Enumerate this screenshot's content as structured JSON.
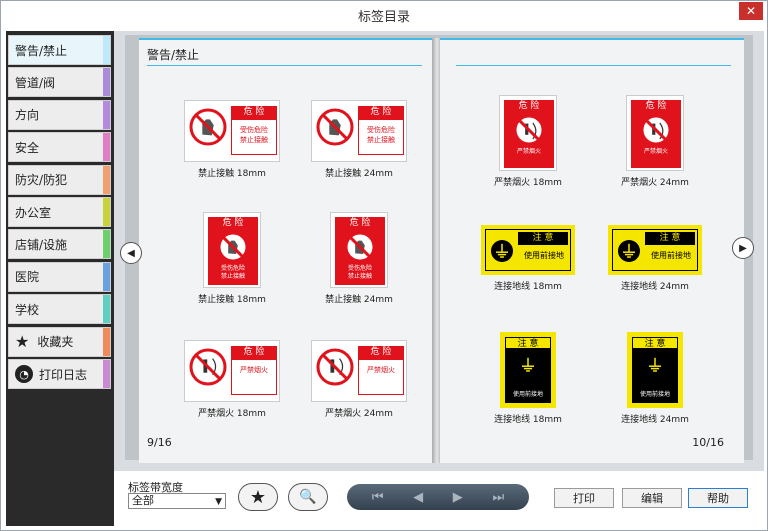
{
  "window": {
    "title": "标签目录",
    "close_glyph": "✕"
  },
  "sidebar": {
    "items": [
      {
        "label": "警告/禁止",
        "accent": "#bfe9fb",
        "active": true
      },
      {
        "label": "管道/阀",
        "accent": "#a98bd8"
      },
      {
        "label": "方向",
        "accent": "#b48ae0"
      },
      {
        "label": "安全",
        "accent": "#e07ec4"
      },
      {
        "label": "防灾/防犯",
        "accent": "#f0a070"
      },
      {
        "label": "办公室",
        "accent": "#c8d23a"
      },
      {
        "label": "店铺/设施",
        "accent": "#6fcf6f"
      },
      {
        "label": "医院",
        "accent": "#6aa0e0"
      },
      {
        "label": "学校",
        "accent": "#5fcfc0"
      },
      {
        "label": "收藏夹",
        "accent": "#f08a5a",
        "icon": "star-icon"
      },
      {
        "label": "打印日志",
        "accent": "#c88ad0",
        "icon": "clock-icon"
      }
    ]
  },
  "book": {
    "left": {
      "title": "警告/禁止",
      "page_number": "9/16",
      "labels": [
        {
          "caption": "禁止接触 18mm",
          "kind": "hand-h",
          "head": "危 险",
          "line1": "受伤危险",
          "line2": "禁止接触"
        },
        {
          "caption": "禁止接触 24mm",
          "kind": "hand-h",
          "head": "危 险",
          "line1": "受伤危险",
          "line2": "禁止接触"
        },
        {
          "caption": "禁止接触 18mm",
          "kind": "hand-v",
          "head": "危 险",
          "line1": "受伤危险",
          "line2": "禁止接触"
        },
        {
          "caption": "禁止接触 24mm",
          "kind": "hand-v",
          "head": "危 险",
          "line1": "受伤危险",
          "line2": "禁止接触"
        },
        {
          "caption": "严禁烟火 18mm",
          "kind": "fire-h",
          "head": "危 险",
          "line1": "严禁烟火",
          "line2": ""
        },
        {
          "caption": "严禁烟火 24mm",
          "kind": "fire-h",
          "head": "危 险",
          "line1": "严禁烟火",
          "line2": ""
        }
      ]
    },
    "right": {
      "page_number": "10/16",
      "labels": [
        {
          "caption": "严禁烟火 18mm",
          "kind": "fire-v",
          "head": "危 险",
          "line1": "严禁烟火",
          "line2": ""
        },
        {
          "caption": "严禁烟火 24mm",
          "kind": "fire-v",
          "head": "危 险",
          "line1": "严禁烟火",
          "line2": ""
        },
        {
          "caption": "连接地线 18mm",
          "kind": "ground-h",
          "head": "注 意",
          "line1": "使用前接地",
          "line2": ""
        },
        {
          "caption": "连接地线 24mm",
          "kind": "ground-h",
          "head": "注 意",
          "line1": "使用前接地",
          "line2": ""
        },
        {
          "caption": "连接地线 18mm",
          "kind": "ground-v",
          "head": "注 意",
          "line1": "使用前接地",
          "line2": ""
        },
        {
          "caption": "连接地线 24mm",
          "kind": "ground-v",
          "head": "注 意",
          "line1": "使用前接地",
          "line2": ""
        }
      ]
    }
  },
  "nav": {
    "prev_glyph": "◀",
    "next_glyph": "▶"
  },
  "footer": {
    "tape_width_label": "标签带宽度",
    "tape_width_value": "全部",
    "favorite_glyph": "★",
    "zoom_glyph": "🔍",
    "pager": {
      "first": "⏮",
      "prev": "◀",
      "next": "▶",
      "last": "⏭"
    },
    "print_label": "打印",
    "edit_label": "编辑",
    "help_label": "帮助"
  },
  "colors": {
    "accent_blue": "#41b8e8",
    "danger_red": "#e0121c",
    "caution_yellow": "#f5e600"
  }
}
